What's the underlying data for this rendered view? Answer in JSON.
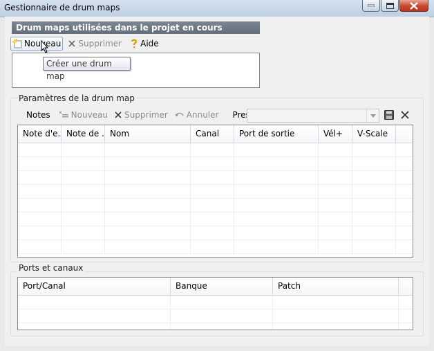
{
  "window": {
    "title": "Gestionnaire de drum maps"
  },
  "maps_section": {
    "header": "Drum maps utilisées dans le projet en cours",
    "toolbar": {
      "new_label": "Nouveau",
      "delete_label": "Supprimer",
      "help_label": "Aide"
    },
    "tooltip": "Créer une drum map"
  },
  "params_section": {
    "label": "Paramètres de la drum map",
    "toolbar": {
      "notes_label": "Notes",
      "new_label": "Nouveau",
      "delete_label": "Supprimer",
      "undo_label": "Annuler",
      "presets_label": "Presets",
      "presets_value": ""
    },
    "columns": [
      "Note d'e...",
      "Note de ...",
      "Nom",
      "Canal",
      "Port de sortie",
      "Vél+",
      "V-Scale"
    ],
    "empty_rows": 8
  },
  "ports_section": {
    "label": "Ports et canaux",
    "columns": [
      "Port/Canal",
      "Banque",
      "Patch"
    ],
    "empty_rows": 3
  },
  "icons": {
    "new": "new-document-icon",
    "delete": "x-delete-icon",
    "help": "help-question-icon",
    "undo": "undo-icon",
    "save": "save-disk-icon",
    "close": "close-x-icon"
  }
}
